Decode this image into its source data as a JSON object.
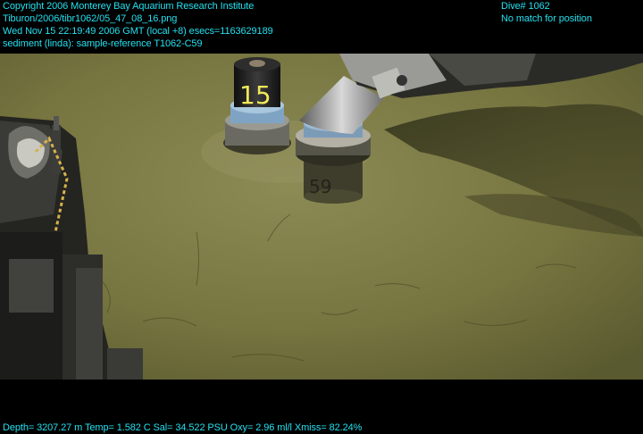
{
  "overlay": {
    "top_left": [
      "Copyright 2006 Monterey Bay Aquarium Research Institute",
      "Tiburon/2006/tibr1062/05_47_08_16.png",
      "Wed Nov 15 22:19:49 2006 GMT (local +8)  esecs=1163629189",
      "sediment (linda): sample-reference T1062-C59"
    ],
    "top_right": [
      "Dive# 1062",
      "No match for position"
    ],
    "bottom": "Depth= 3207.27 m  Temp= 1.582 C  Sal= 34.522 PSU  Oxy= 2.96 ml/l  Xmiss= 82.24%"
  },
  "scene": {
    "core_left_label": "15",
    "core_right_label": "59",
    "colors": {
      "overlay_text": "#23e0ef",
      "sediment": "#7c7a45",
      "background": "#000000"
    }
  }
}
